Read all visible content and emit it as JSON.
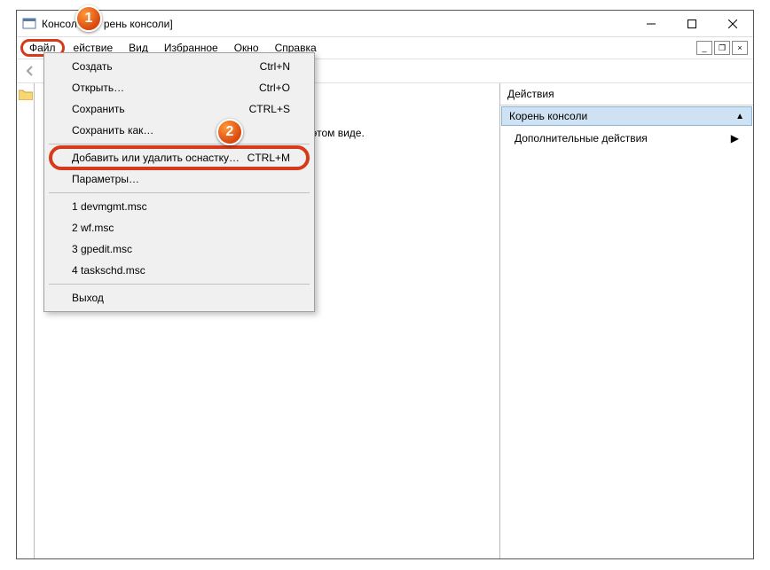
{
  "titlebar": {
    "prefix": "Консол",
    "suffix": "рень консоли]"
  },
  "menubar": {
    "file": "Файл",
    "action": "ействие",
    "view": "Вид",
    "favorites": "Избранное",
    "window": "Окно",
    "help": "Справка"
  },
  "dropdown": {
    "create": "Создать",
    "create_sc": "Ctrl+N",
    "open": "Открыть…",
    "open_sc": "Ctrl+O",
    "save": "Сохранить",
    "save_sc": "CTRL+S",
    "saveas": "Сохранить как…",
    "addremove": "Добавить или удалить оснастку…",
    "addremove_sc": "CTRL+M",
    "options": "Параметры…",
    "recent1": "1 devmgmt.msc",
    "recent2": "2 wf.msc",
    "recent3": "3 gpedit.msc",
    "recent4": "4 taskschd.msc",
    "exit": "Выход"
  },
  "empty": {
    "line": "ементов для отображения в этом виде."
  },
  "actions": {
    "header": "Действия",
    "root": "Корень консоли",
    "more": "Дополнительные действия"
  },
  "callouts": {
    "one": "1",
    "two": "2"
  }
}
